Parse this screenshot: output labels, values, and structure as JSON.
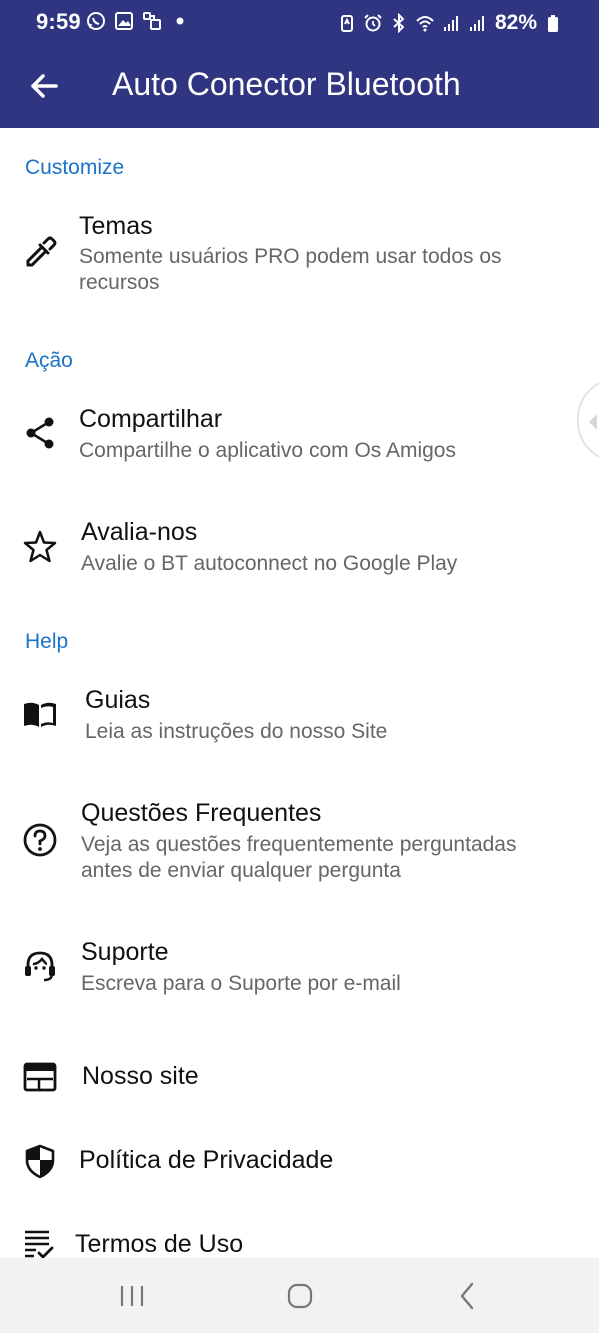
{
  "status_bar": {
    "time": "9:59",
    "left_icons": [
      "whatsapp-icon",
      "gallery-icon",
      "link-icon",
      "dot-icon"
    ],
    "right_icons": [
      "battery-saver-icon",
      "alarm-icon",
      "bluetooth-icon",
      "wifi-icon",
      "signal-icon",
      "signal-icon"
    ],
    "battery": "82%"
  },
  "app_bar": {
    "title": "Auto Conector Bluetooth",
    "back_icon": "arrow-left-icon",
    "color": "#2f3581"
  },
  "accent_color": "#1a73c8",
  "sections": {
    "customize": {
      "header": "Customize",
      "items": {
        "temas": {
          "title": "Temas",
          "subtitle": "Somente usuários PRO podem usar todos os recursos",
          "icon": "eyedropper-icon"
        }
      }
    },
    "acao": {
      "header": "Ação",
      "items": {
        "compartilhar": {
          "title": "Compartilhar",
          "subtitle": "Compartilhe o aplicativo com Os Amigos",
          "icon": "share-icon"
        },
        "avalie": {
          "title": "Avalia-nos",
          "subtitle": "Avalie o BT autoconnect no Google Play",
          "icon": "star-icon"
        }
      }
    },
    "help": {
      "header": "Help",
      "items": {
        "guias": {
          "title": "Guias",
          "subtitle": "Leia as instruções do nosso Site",
          "icon": "book-icon"
        },
        "faq": {
          "title": "Questões Frequentes",
          "subtitle": "Veja as questões frequentemente perguntadas antes de enviar qualquer pergunta",
          "icon": "help-circle-icon"
        },
        "suporte": {
          "title": "Suporte",
          "subtitle": "Escreva para o Suporte por e-mail",
          "icon": "headset-icon"
        },
        "site": {
          "title": "Nosso site",
          "icon": "web-icon"
        },
        "privacidade": {
          "title": "Política de Privacidade",
          "icon": "shield-icon"
        },
        "termos": {
          "title": "Termos de Uso",
          "icon": "list-check-icon"
        }
      }
    }
  },
  "nav_bar": {
    "buttons": [
      "recents-icon",
      "home-icon",
      "back-icon"
    ]
  }
}
